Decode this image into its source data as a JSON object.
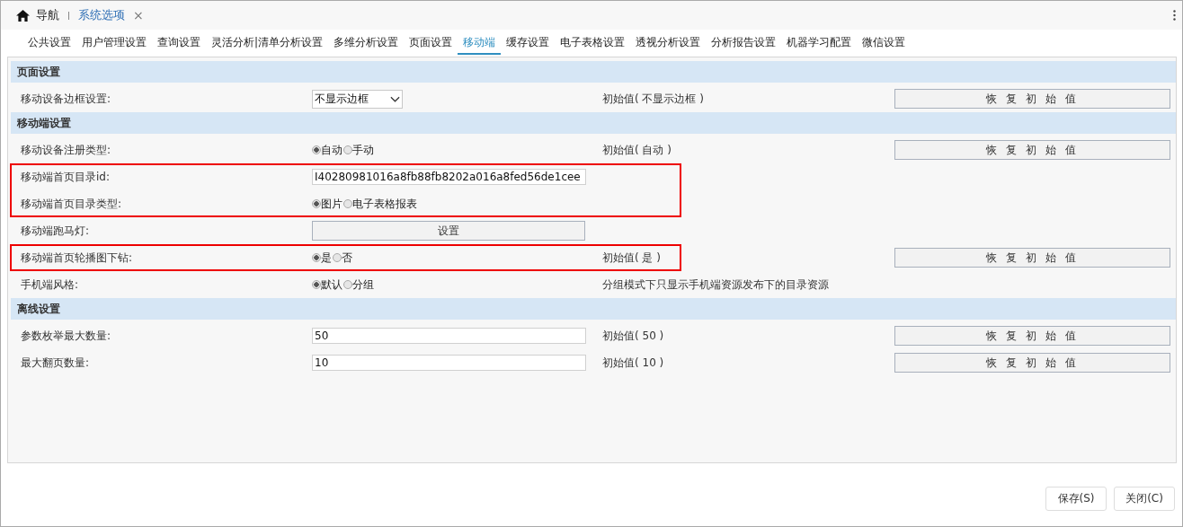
{
  "nav": {
    "home_label": "导航",
    "open_tab": "系统选项",
    "close": "×"
  },
  "tabs": [
    {
      "label": "公共设置",
      "selected": false
    },
    {
      "label": "用户管理设置",
      "selected": false
    },
    {
      "label": "查询设置",
      "selected": false
    },
    {
      "label": "灵活分析|清单分析设置",
      "selected": false
    },
    {
      "label": "多维分析设置",
      "selected": false
    },
    {
      "label": "页面设置",
      "selected": false
    },
    {
      "label": "移动端",
      "selected": true
    },
    {
      "label": "缓存设置",
      "selected": false
    },
    {
      "label": "电子表格设置",
      "selected": false
    },
    {
      "label": "透视分析设置",
      "selected": false
    },
    {
      "label": "分析报告设置",
      "selected": false
    },
    {
      "label": "机器学习配置",
      "selected": false
    },
    {
      "label": "微信设置",
      "selected": false
    }
  ],
  "sections": [
    {
      "title": "页面设置",
      "blocks": [
        {
          "outlined": false,
          "rows": [
            {
              "label": "移动设备边框设置:",
              "kind": "select",
              "value": "不显示边框",
              "initial": "初始值( 不显示边框 )",
              "reset": "恢 复 初 始 值"
            }
          ]
        }
      ]
    },
    {
      "title": "移动端设置",
      "blocks": [
        {
          "outlined": false,
          "rows": [
            {
              "label": "移动设备注册类型:",
              "kind": "radio",
              "options": [
                {
                  "label": "自动",
                  "selected": true
                },
                {
                  "label": "手动",
                  "selected": false
                }
              ],
              "initial": "初始值( 自动 )",
              "reset": "恢 复 初 始 值"
            }
          ]
        },
        {
          "outlined": true,
          "rows": [
            {
              "label": "移动端首页目录id:",
              "kind": "text",
              "value": "I40280981016a8fb88fb8202a016a8fed56de1cee"
            },
            {
              "label": "移动端首页目录类型:",
              "kind": "radio",
              "options": [
                {
                  "label": "图片",
                  "selected": true
                },
                {
                  "label": "电子表格报表",
                  "selected": false
                }
              ]
            }
          ]
        },
        {
          "outlined": false,
          "rows": [
            {
              "label": "移动端跑马灯:",
              "kind": "button",
              "value": "设置"
            }
          ]
        },
        {
          "outlined": true,
          "rows": [
            {
              "label": "移动端首页轮播图下钻:",
              "kind": "radio",
              "options": [
                {
                  "label": "是",
                  "selected": true
                },
                {
                  "label": "否",
                  "selected": false
                }
              ],
              "initial": "初始值( 是 )",
              "reset": "恢 复 初 始 值"
            }
          ]
        },
        {
          "outlined": false,
          "rows": [
            {
              "label": "手机端风格:",
              "kind": "radio",
              "options": [
                {
                  "label": "默认",
                  "selected": true
                },
                {
                  "label": "分组",
                  "selected": false
                }
              ],
              "initial": "分组模式下只显示手机端资源发布下的目录资源"
            }
          ]
        }
      ]
    },
    {
      "title": "离线设置",
      "blocks": [
        {
          "outlined": false,
          "rows": [
            {
              "label": "参数枚举最大数量:",
              "kind": "text",
              "value": "50",
              "initial": "初始值( 50 )",
              "reset": "恢 复 初 始 值"
            },
            {
              "label": "最大翻页数量:",
              "kind": "text",
              "value": "10",
              "initial": "初始值( 10 )",
              "reset": "恢 复 初 始 值"
            }
          ]
        }
      ]
    }
  ],
  "footer": [
    "保存(S)",
    "关闭(C)"
  ]
}
